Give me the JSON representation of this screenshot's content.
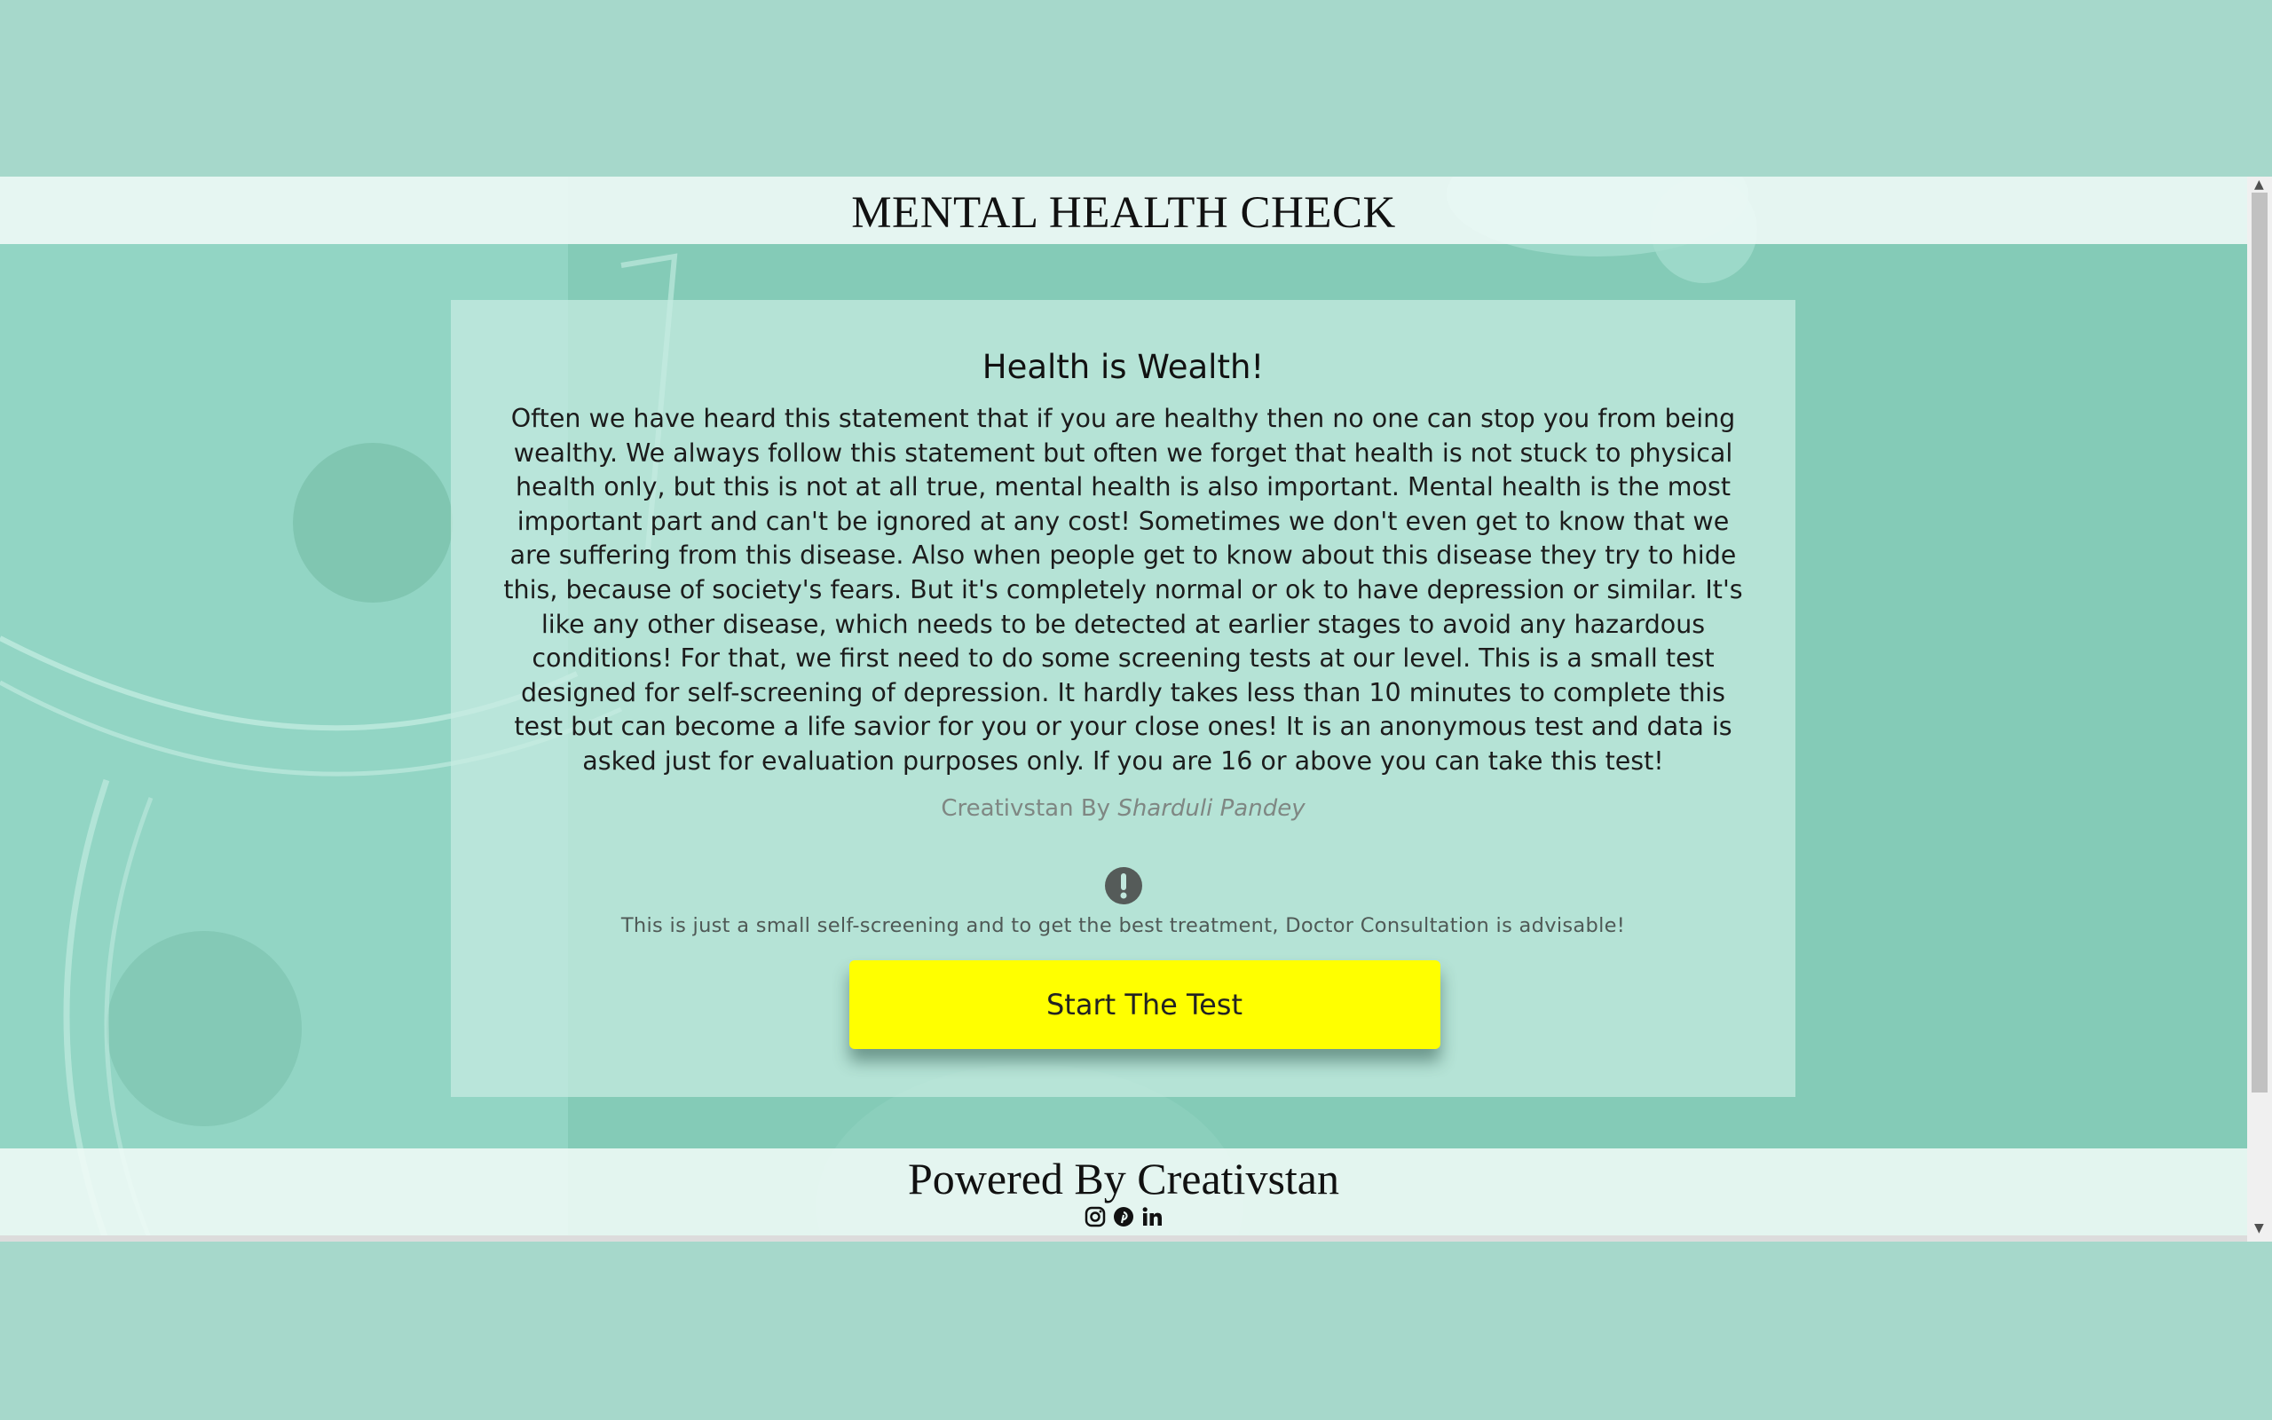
{
  "header": {
    "title": "MENTAL HEALTH CHECK"
  },
  "card": {
    "title": "Health is Wealth!",
    "body": "Often we have heard this statement that if you are healthy then no one can stop you from being wealthy. We always follow this statement but often we forget that health is not stuck to physical health only, but this is not at all true, mental health is also important. Mental health is the most important part and can't be ignored at any cost! Sometimes we don't even get to know that we are suffering from this disease. Also when people get to know about this disease they try to hide this, because of society's fears. But it's completely normal or ok to have depression or similar. It's like any other disease, which needs to be detected at earlier stages to avoid any hazardous conditions! For that, we first need to do some screening tests at our level. This is a small test designed for self-screening of depression. It hardly takes less than 10 minutes to complete this test but can become a life savior for you or your close ones! It is an anonymous test and data is asked just for evaluation purposes only. If you are 16 or above you can take this test!",
    "credit_prefix": "Creativstan By ",
    "credit_author": "Sharduli Pandey",
    "warning_icon": "exclamation-circle-icon",
    "disclaimer": "This is just a small self-screening and to get the best treatment, Doctor Consultation is advisable!",
    "start_button_label": "Start The Test"
  },
  "footer": {
    "text": "Powered By Creativstan",
    "social_icons": [
      "instagram-icon",
      "pinterest-icon",
      "linkedin-icon"
    ]
  },
  "colors": {
    "page_background": "#a6d8cb",
    "content_background": "#84cbb7",
    "button": "#ffff00"
  }
}
